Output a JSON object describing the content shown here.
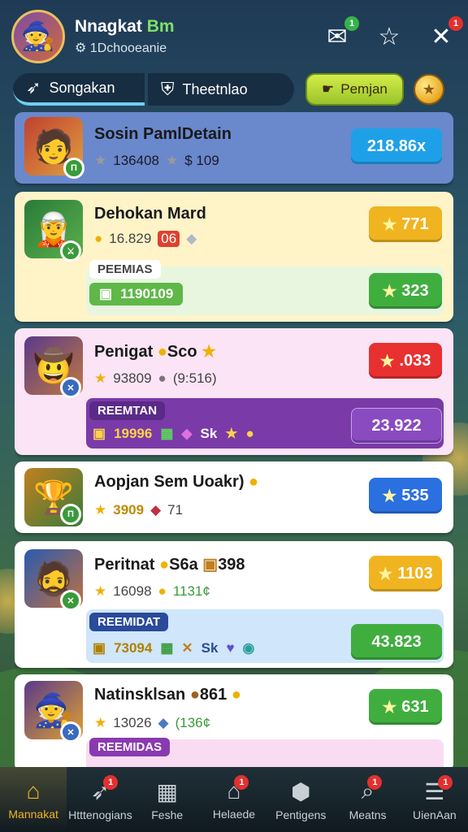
{
  "header": {
    "user_name_a": "Nnagkat ",
    "user_name_b": "Bm",
    "user_sub": "⚙ 1Dchooeanie",
    "icons": [
      {
        "name": "mail-icon",
        "glyph": "✉",
        "badge": "1",
        "badge_color": "green"
      },
      {
        "name": "star-outline-icon",
        "glyph": "☆",
        "badge": ""
      },
      {
        "name": "close-icon",
        "glyph": "✕",
        "badge": "1",
        "badge_color": "red"
      }
    ]
  },
  "tabs": {
    "tab1": "Songakan",
    "tab2": "Theetnlao",
    "button": "Pemjan"
  },
  "cards": [
    {
      "title": "Sosin PamlDetain",
      "stat1": "136408",
      "stat2": "$ 109",
      "pill": "218.86x",
      "pill_color": "#1ea0e8",
      "bg": "#5b7ec8"
    },
    {
      "title": "Dehokan Mard",
      "stat1": "16.829",
      "stat2": "06",
      "pill": "771",
      "tag": "PEEMIAS",
      "strip_value": "1190109",
      "pill2": "323"
    },
    {
      "title": "Penigat",
      "title_suffix": "Sco",
      "stat1": "93809",
      "stat2": "(9:516)",
      "pill": ".033",
      "tag": "REEMTAN",
      "strip_value": "19996",
      "strip_extra": "Sk",
      "strip_pill": "23.922"
    },
    {
      "title": "Aopjan Sem Uoakr)",
      "stat1": "3909",
      "stat2": "71",
      "pill": "535"
    },
    {
      "title": "Peritnat",
      "title_suffix": "S6a",
      "title_suffix2": "398",
      "stat1": "16098",
      "stat2": "1131¢",
      "pill": "1103",
      "tag": "REEMIDAT",
      "strip_value": "73094",
      "strip_extra": "Sk",
      "strip_pill": "43.823"
    },
    {
      "title": "Natinsklsan",
      "title_suffix": "861",
      "stat1": "13026",
      "stat2": "(136¢",
      "pill": "631",
      "tag": "REEMIDAS"
    }
  ],
  "bottom_nav": [
    {
      "label": "Mannakat",
      "icon": "home-icon",
      "glyph": "⌂",
      "active": true,
      "badge": ""
    },
    {
      "label": "Htttenogians",
      "icon": "rocket-icon",
      "glyph": "➶",
      "active": false,
      "badge": "1"
    },
    {
      "label": "Feshe",
      "icon": "calendar-icon",
      "glyph": "▦",
      "active": false,
      "badge": ""
    },
    {
      "label": "Helaede",
      "icon": "house-icon",
      "glyph": "⌂",
      "active": false,
      "badge": "1"
    },
    {
      "label": "Pentigens",
      "icon": "shield-icon",
      "glyph": "⬢",
      "active": false,
      "badge": ""
    },
    {
      "label": "Meatns",
      "icon": "search-icon",
      "glyph": "⌕",
      "active": false,
      "badge": "1"
    },
    {
      "label": "UienAan",
      "icon": "menu-icon",
      "glyph": "☰",
      "active": false,
      "badge": "1"
    }
  ]
}
